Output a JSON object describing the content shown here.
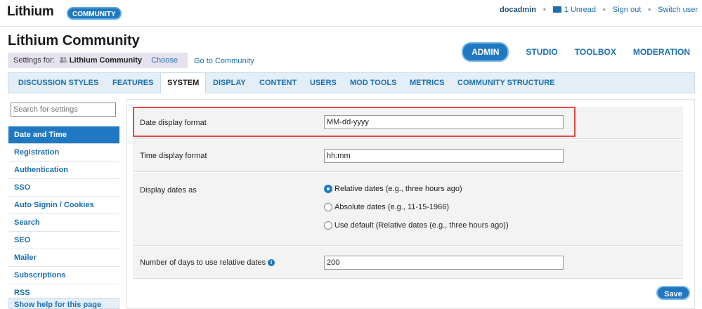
{
  "topbar": {
    "logo": "Lithium",
    "community_pill": "COMMUNITY",
    "user": "docadmin",
    "unread": "1 Unread",
    "sign_out": "Sign out",
    "switch_user": "Switch user"
  },
  "header": {
    "title": "Lithium Community",
    "settings_for_label": "Settings for:",
    "settings_for_value": "Lithium Community",
    "choose": "Choose",
    "goto": "Go to Community"
  },
  "mainnav": {
    "items": [
      "ADMIN",
      "STUDIO",
      "TOOLBOX",
      "MODERATION"
    ],
    "active": "ADMIN"
  },
  "tabs": {
    "items": [
      "DISCUSSION STYLES",
      "FEATURES",
      "SYSTEM",
      "DISPLAY",
      "CONTENT",
      "USERS",
      "MOD TOOLS",
      "METRICS",
      "COMMUNITY STRUCTURE"
    ],
    "active": "SYSTEM"
  },
  "sidebar": {
    "search_placeholder": "Search for settings",
    "items": [
      "Date and Time",
      "Registration",
      "Authentication",
      "SSO",
      "Auto Signin / Cookies",
      "Search",
      "SEO",
      "Mailer",
      "Subscriptions",
      "RSS"
    ],
    "active": "Date and Time",
    "help": "Show help for this page"
  },
  "form": {
    "date_format_label": "Date display format",
    "date_format_value": "MM-dd-yyyy",
    "time_format_label": "Time display format",
    "time_format_value": "hh:mm",
    "display_dates_label": "Display dates as",
    "display_options": [
      "Relative dates (e.g., three hours ago)",
      "Absolute dates (e.g., 11-15-1966)",
      "Use default (Relative dates (e.g., three hours ago))"
    ],
    "display_selected_index": 0,
    "relative_days_label": "Number of days to use relative dates",
    "relative_days_value": "200",
    "save": "Save"
  },
  "colors": {
    "accent": "#1f78c1",
    "highlight": "#e04a46"
  }
}
